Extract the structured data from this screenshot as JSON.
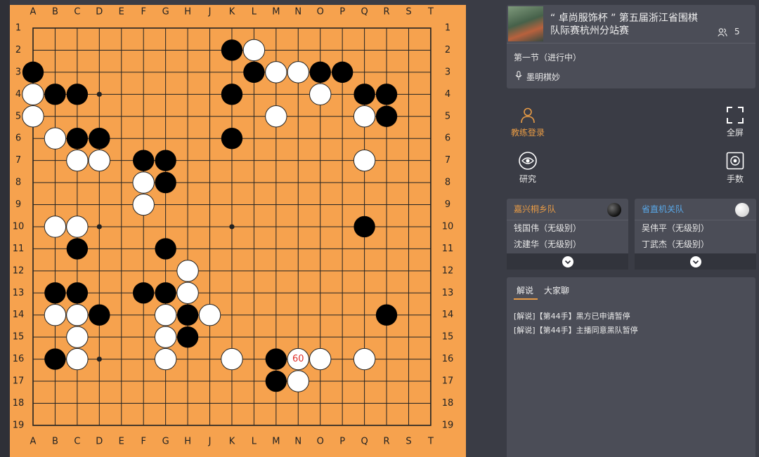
{
  "board": {
    "columns": [
      "A",
      "B",
      "C",
      "D",
      "E",
      "F",
      "G",
      "H",
      "J",
      "K",
      "L",
      "M",
      "N",
      "O",
      "P",
      "Q",
      "R",
      "S",
      "T"
    ],
    "rows": [
      "1",
      "2",
      "3",
      "4",
      "5",
      "6",
      "7",
      "8",
      "9",
      "10",
      "11",
      "12",
      "13",
      "14",
      "15",
      "16",
      "17",
      "18",
      "19"
    ],
    "colors": {
      "wood": "#f6a24e",
      "line": "#222222",
      "black": "#000000",
      "white": "#ffffff",
      "label_red": "#e0302a"
    },
    "star_points": [
      "D4",
      "K4",
      "Q4",
      "D10",
      "K10",
      "Q10",
      "D16",
      "K16",
      "Q16"
    ],
    "black_stones": [
      "K2",
      "L3",
      "O3",
      "P3",
      "Q4",
      "R4",
      "R5",
      "A3",
      "B4",
      "C4",
      "K4",
      "K6",
      "C6",
      "D6",
      "F7",
      "G7",
      "G8",
      "Q10",
      "C11",
      "G11",
      "B13",
      "C13",
      "F13",
      "G13",
      "D14",
      "H14",
      "R14",
      "H15",
      "B16",
      "M16",
      "M17"
    ],
    "white_stones": [
      "L2",
      "M3",
      "N3",
      "O4",
      "A4",
      "A5",
      "M5",
      "Q5",
      "B6",
      "C7",
      "D7",
      "Q7",
      "F8",
      "F9",
      "B10",
      "C10",
      "H12",
      "H13",
      "B14",
      "C14",
      "G14",
      "J14",
      "C15",
      "G15",
      "C16",
      "G16",
      "K16",
      "O16",
      "Q16",
      "N17"
    ],
    "labeled_stone": {
      "point": "N16",
      "color": "white",
      "label": "60"
    }
  },
  "match": {
    "title_line1": "“ 卓尚服饰杯 ” 第五届浙江省围棋",
    "title_line2": "队际赛杭州分站赛",
    "viewer_count": "5",
    "session": "第一节（进行中）",
    "commentator": "墨明棋妙"
  },
  "tools": {
    "coach_login": "教练登录",
    "fullscreen": "全屏",
    "study": "研究",
    "move_numbers": "手数"
  },
  "teams": {
    "black": {
      "name": "嘉兴桐乡队",
      "player1": "钱国伟（无级别）",
      "player2": "沈建华（无级别）"
    },
    "white": {
      "name": "省直机关队",
      "player1": "吴伟平（无级别）",
      "player2": "丁武杰（无级别）"
    }
  },
  "chat": {
    "tab_commentary": "解说",
    "tab_chat": "大家聊",
    "messages": [
      "[解说]【第44手】黑方已申请暂停",
      "[解说]【第44手】主播同意黑队暂停"
    ]
  },
  "icons": [
    "user-icon",
    "fullscreen-icon",
    "eye-icon",
    "move-number-icon",
    "mic-icon",
    "viewers-icon",
    "chevron-down-icon"
  ]
}
